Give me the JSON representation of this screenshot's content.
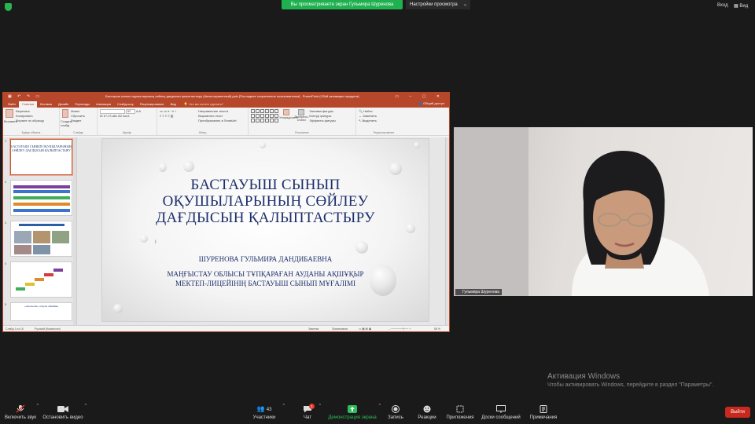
{
  "topbar": {
    "banner": "Вы просматриваете экран Гульмира Шуренова",
    "view_options": "Настройки просмотра",
    "enter": "Вход",
    "view": "Вид"
  },
  "ppt": {
    "window_title": "Бастауыш сынып оқушыларының сөйлеу дағдысын қалыптастыру (Автосохраненный).pptx [Последнее сохраненное пользователем] - PowerPoint (Сбой активации продукта)",
    "tabs": [
      "Файл",
      "Главная",
      "Вставка",
      "Дизайн",
      "Переходы",
      "Анимация",
      "Слайд-шоу",
      "Рецензирование",
      "Вид"
    ],
    "active_tab": "Главная",
    "tell_me": "Что вы хотите сделать?",
    "share": "Общий доступ",
    "ribbon": {
      "clipboard": {
        "paste": "Вставить",
        "cut": "Вырезать",
        "copy": "Копировать",
        "format": "Формат по образцу",
        "label": "Буфер обмена"
      },
      "slides": {
        "new": "Создать слайд",
        "layout": "Макет",
        "reset": "Сбросить",
        "section": "Раздел",
        "label": "Слайды"
      },
      "font": {
        "size": "60",
        "label": "Шрифт"
      },
      "paragraph": {
        "dir": "Направление текста",
        "align": "Выровнять текст",
        "smart": "Преобразовать в SmartArt",
        "label": "Абзац"
      },
      "drawing": {
        "arrange": "Упорядочить",
        "quick": "Экспресс-стили",
        "fill": "Заливка фигуры",
        "outline": "Контур фигуры",
        "effects": "Эффекты фигуры",
        "label": "Рисование"
      },
      "editing": {
        "find": "Найти",
        "replace": "Заменить",
        "select": "Выделить",
        "label": "Редактирование"
      }
    },
    "thumbs": [
      "1",
      "2",
      "3",
      "4",
      "5"
    ],
    "thumb1_title": "БАСТАУЫШ СЫНЫП ОҚУШЫЛАРЫНЫҢ СӨЙЛЕУ ДАҒДЫСЫН ҚАЛЫПТАСТЫРУ",
    "thumb5_title": "«Апельсин» атаулы ойнайық",
    "slide": {
      "title_lines": [
        "БАСТАУЫШ СЫНЫП",
        "ОҚУШЫЛАРЫНЫҢ СӨЙЛЕУ",
        "ДАҒДЫСЫН ҚАЛЫПТАСТЫРУ"
      ],
      "author": "ШУРЕНОВА ГУЛЬМИРА ДАНДИБАЕВНА",
      "sub_lines": [
        "МАҢҒЫСТАУ ОБЛЫСЫ ТҰПҚАРАҒАН АУДАНЫ АҚШҰҚЫР",
        "МЕКТЕП-ЛИЦЕЙІНІҢ БАСТАУЫШ СЫНЫП МҰҒАЛІМІ"
      ]
    },
    "status": {
      "slide_of": "Слайд 1 из 16",
      "lang": "Русский (Казахстан)",
      "notes": "Заметки",
      "comments": "Примечания",
      "zoom": "58 %"
    }
  },
  "video": {
    "name": "Гульмира Шуренова"
  },
  "activation": {
    "title": "Активация Windows",
    "text": "Чтобы активировать Windows, перейдите в раздел \"Параметры\"."
  },
  "toolbar": {
    "mic": "Включить звук",
    "video": "Остановить видео",
    "participants": "Участники",
    "participants_count": "43",
    "chat": "Чат",
    "chat_badge": "1",
    "share": "Демонстрация экрана",
    "record": "Запись",
    "reactions": "Реакции",
    "apps": "Приложения",
    "whiteboards": "Доски сообщений",
    "notes": "Примечания",
    "leave": "Выйти"
  },
  "colors": {
    "accent_green": "#1fb14f",
    "ppt_red": "#b7472a",
    "leave_red": "#c8291e",
    "slide_text": "#1d2f6b"
  }
}
